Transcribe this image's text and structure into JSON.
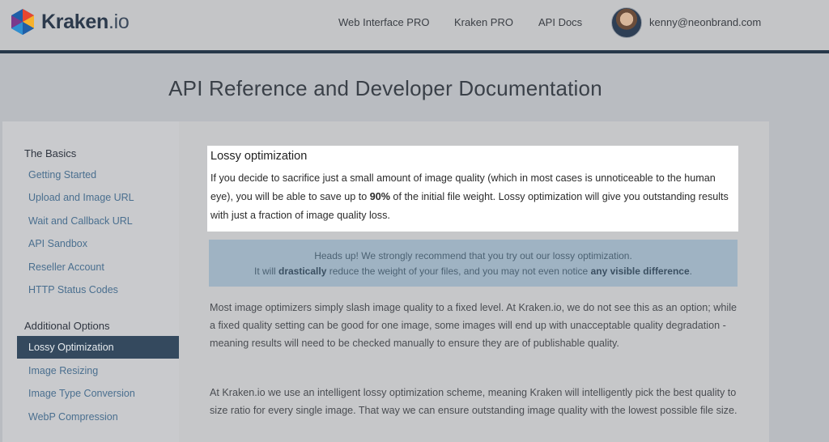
{
  "header": {
    "brand_name": "Kraken",
    "brand_tld": ".io",
    "nav": [
      {
        "label": "Web Interface PRO"
      },
      {
        "label": "Kraken PRO"
      },
      {
        "label": "API Docs"
      }
    ],
    "user_email": "kenny@neonbrand.com"
  },
  "page": {
    "title": "API Reference and Developer Documentation"
  },
  "sidebar": {
    "sections": [
      {
        "heading": "The Basics",
        "items": [
          {
            "label": "Getting Started"
          },
          {
            "label": "Upload and Image URL"
          },
          {
            "label": "Wait and Callback URL"
          },
          {
            "label": "API Sandbox"
          },
          {
            "label": "Reseller Account"
          },
          {
            "label": "HTTP Status Codes"
          }
        ]
      },
      {
        "heading": "Additional Options",
        "items": [
          {
            "label": "Lossy Optimization",
            "active": true
          },
          {
            "label": "Image Resizing"
          },
          {
            "label": "Image Type Conversion"
          },
          {
            "label": "WebP Compression"
          }
        ]
      }
    ]
  },
  "content": {
    "section_title": "Lossy optimization",
    "intro": {
      "part1": "If you decide to sacrifice just a small amount of image quality (which in most cases is unnoticeable to the human eye), you will be able to save up to ",
      "bold": "90%",
      "part2": " of the initial file weight. Lossy optimization will give you outstanding results with just a fraction of image quality loss."
    },
    "alert": {
      "line1": "Heads up! We strongly recommend that you try out our lossy optimization.",
      "line2_a": "It will ",
      "line2_bold1": "drastically",
      "line2_b": " reduce the weight of your files, and you may not even notice ",
      "line2_bold2": "any visible difference",
      "line2_c": "."
    },
    "paragraphs": [
      "Most image optimizers simply slash image quality to a fixed level. At Kraken.io, we do not see this as an option; while a fixed quality setting can be good for one image, some images will end up with unacceptable quality degradation - meaning results will need to be checked manually to ensure they are of publishable quality.",
      "At Kraken.io we use an intelligent lossy optimization scheme, meaning Kraken will intelligently pick the best quality to size ratio for every single image. That way we can ensure outstanding image quality with the lowest possible file size."
    ]
  },
  "colors": {
    "header_border": "#27384a",
    "sidebar_active_bg": "#34495e",
    "link": "#4a6f8f",
    "alert_bg": "#9fb3c3"
  }
}
